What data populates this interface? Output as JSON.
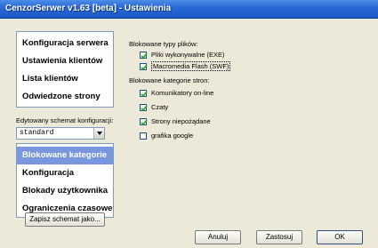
{
  "window": {
    "title": "CenzorSerwer v1.63 [beta] - Ustawienia"
  },
  "sidebar": {
    "top_items": [
      {
        "label": "Konfiguracja serwera"
      },
      {
        "label": "Ustawienia klientów"
      },
      {
        "label": "Lista klientów"
      },
      {
        "label": "Odwiedzone strony"
      }
    ],
    "schema_label": "Edytowany schemat konfiguracji:",
    "schema_value": "standard",
    "bottom_items": [
      {
        "label": "Blokowane kategorie",
        "active": true
      },
      {
        "label": "Konfiguracja"
      },
      {
        "label": "Blokady użytkownika"
      },
      {
        "label": "Ograniczenia czasowe"
      }
    ],
    "save_schema_button": "Zapisz schemat jako..."
  },
  "main": {
    "file_types_label": "Blokowane typy plików:",
    "file_types": [
      {
        "label": "Pliki wykonywalne (EXE)",
        "checked": true
      },
      {
        "label": "Macromedia Flash (SWF)",
        "checked": true
      }
    ],
    "categories_label": "Blokowane kategorie stron:",
    "categories": [
      {
        "label": "Komunikatory on-line",
        "checked": true
      },
      {
        "label": "Czaty",
        "checked": true
      },
      {
        "label": "Strony niepożądane",
        "checked": true
      },
      {
        "label": "grafika google",
        "checked": false
      }
    ]
  },
  "footer": {
    "cancel_label": "Anuluj",
    "apply_label": "Zastosuj",
    "ok_label": "OK"
  }
}
